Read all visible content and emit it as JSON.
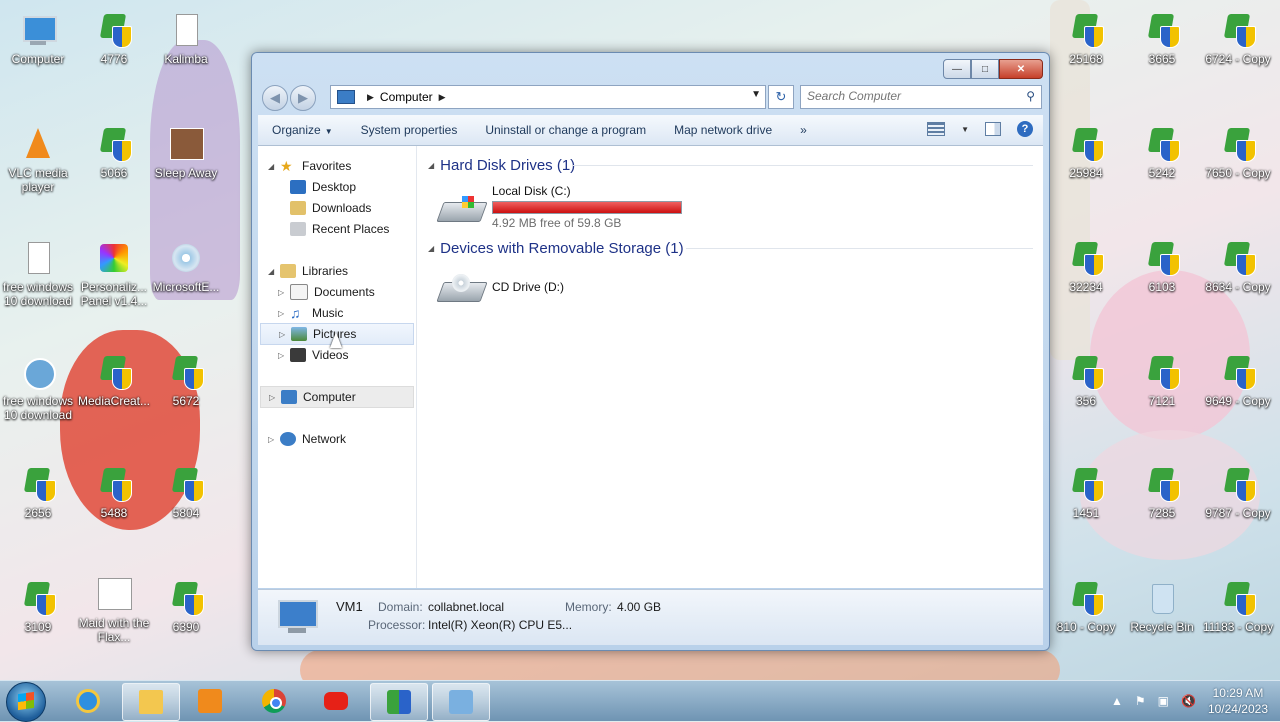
{
  "desktop": {
    "icons": [
      {
        "label": "Computer"
      },
      {
        "label": "4776"
      },
      {
        "label": "Kalimba"
      },
      {
        "label": "25168"
      },
      {
        "label": "3665"
      },
      {
        "label": "6724 - Copy"
      },
      {
        "label": "VLC media player"
      },
      {
        "label": "5066"
      },
      {
        "label": "Sleep Away"
      },
      {
        "label": "25984"
      },
      {
        "label": "5242"
      },
      {
        "label": "7650 - Copy"
      },
      {
        "label": "free windows 10 download"
      },
      {
        "label": "Personaliz... Panel v1.4..."
      },
      {
        "label": "MicrosoftE..."
      },
      {
        "label": "32234"
      },
      {
        "label": "6103"
      },
      {
        "label": "8634 - Copy"
      },
      {
        "label": "free windows 10 download"
      },
      {
        "label": "MediaCreat..."
      },
      {
        "label": "5672"
      },
      {
        "label": "356"
      },
      {
        "label": "7121"
      },
      {
        "label": "9649 - Copy"
      },
      {
        "label": "2656"
      },
      {
        "label": "5488"
      },
      {
        "label": "5804"
      },
      {
        "label": "1451"
      },
      {
        "label": "7285"
      },
      {
        "label": "9787 - Copy"
      },
      {
        "label": "3109"
      },
      {
        "label": "Maid with the Flax..."
      },
      {
        "label": "6390"
      },
      {
        "label": "810 - Copy"
      },
      {
        "label": "Recycle Bin"
      },
      {
        "label": "11183 - Copy"
      }
    ]
  },
  "window": {
    "address": {
      "crumb": "Computer"
    },
    "search": {
      "placeholder": "Search Computer"
    },
    "toolbar": {
      "organize": "Organize",
      "system_properties": "System properties",
      "uninstall": "Uninstall or change a program",
      "map_drive": "Map network drive",
      "more": "»"
    },
    "nav": {
      "favorites": "Favorites",
      "desktop": "Desktop",
      "downloads": "Downloads",
      "recent_places": "Recent Places",
      "libraries": "Libraries",
      "documents": "Documents",
      "music": "Music",
      "pictures": "Pictures",
      "videos": "Videos",
      "computer": "Computer",
      "network": "Network"
    },
    "groups": {
      "hdd": "Hard Disk Drives (1)",
      "removable": "Devices with Removable Storage (1)"
    },
    "drives": {
      "c_name": "Local Disk (C:)",
      "c_free": "4.92 MB free of 59.8 GB",
      "c_used_fraction": 0.9999,
      "d_name": "CD Drive (D:)"
    },
    "details": {
      "name": "VM1",
      "domain_label": "Domain:",
      "domain": "collabnet.local",
      "memory_label": "Memory:",
      "memory": "4.00 GB",
      "processor_label": "Processor:",
      "processor": "Intel(R) Xeon(R) CPU E5..."
    }
  },
  "taskbar": {
    "time": "10:29 AM",
    "date": "10/24/2023"
  }
}
